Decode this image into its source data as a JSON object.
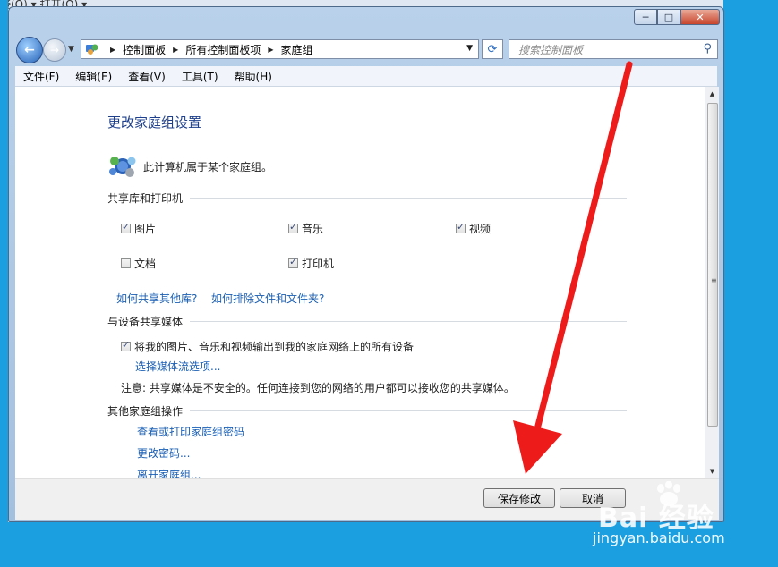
{
  "top_strip": {
    "fragment": "接(O) ▾   打开(O) ▾"
  },
  "window": {
    "caption_buttons": {
      "minimize": "─",
      "maximize": "□",
      "close": "✕"
    }
  },
  "address_bar": {
    "back_icon": "back-arrow-icon",
    "forward_icon": "forward-arrow-icon",
    "breadcrumbs": [
      "控制面板",
      "所有控制面板项",
      "家庭组"
    ],
    "search_placeholder": "搜索控制面板"
  },
  "menu": [
    "文件(F)",
    "编辑(E)",
    "查看(V)",
    "工具(T)",
    "帮助(H)"
  ],
  "main": {
    "title": "更改家庭组设置",
    "status": "此计算机属于某个家庭组。",
    "share_section": {
      "heading": "共享库和打印机",
      "items": [
        {
          "label": "图片",
          "checked": true
        },
        {
          "label": "音乐",
          "checked": true
        },
        {
          "label": "视频",
          "checked": true
        },
        {
          "label": "文档",
          "checked": false
        },
        {
          "label": "打印机",
          "checked": true
        }
      ],
      "links": [
        "如何共享其他库?",
        "如何排除文件和文件夹?"
      ]
    },
    "media_section": {
      "heading": "与设备共享媒体",
      "stream_checkbox": {
        "label": "将我的图片、音乐和视频输出到我的家庭网络上的所有设备",
        "checked": true
      },
      "link": "选择媒体流选项...",
      "note": "注意: 共享媒体是不安全的。任何连接到您的网络的用户都可以接收您的共享媒体。"
    },
    "other_section": {
      "heading": "其他家庭组操作",
      "links": [
        "查看或打印家庭组密码",
        "更改密码...",
        "离开家庭组..."
      ]
    }
  },
  "footer": {
    "save": "保存修改",
    "cancel": "取消"
  },
  "watermark": {
    "logo": "Bai 经验",
    "url": "jingyan.baidu.com"
  },
  "colors": {
    "desktop": "#1b9fe0",
    "link": "#1a5fb4",
    "title": "#1d3f8c",
    "arrow": "#ee1b1b"
  }
}
